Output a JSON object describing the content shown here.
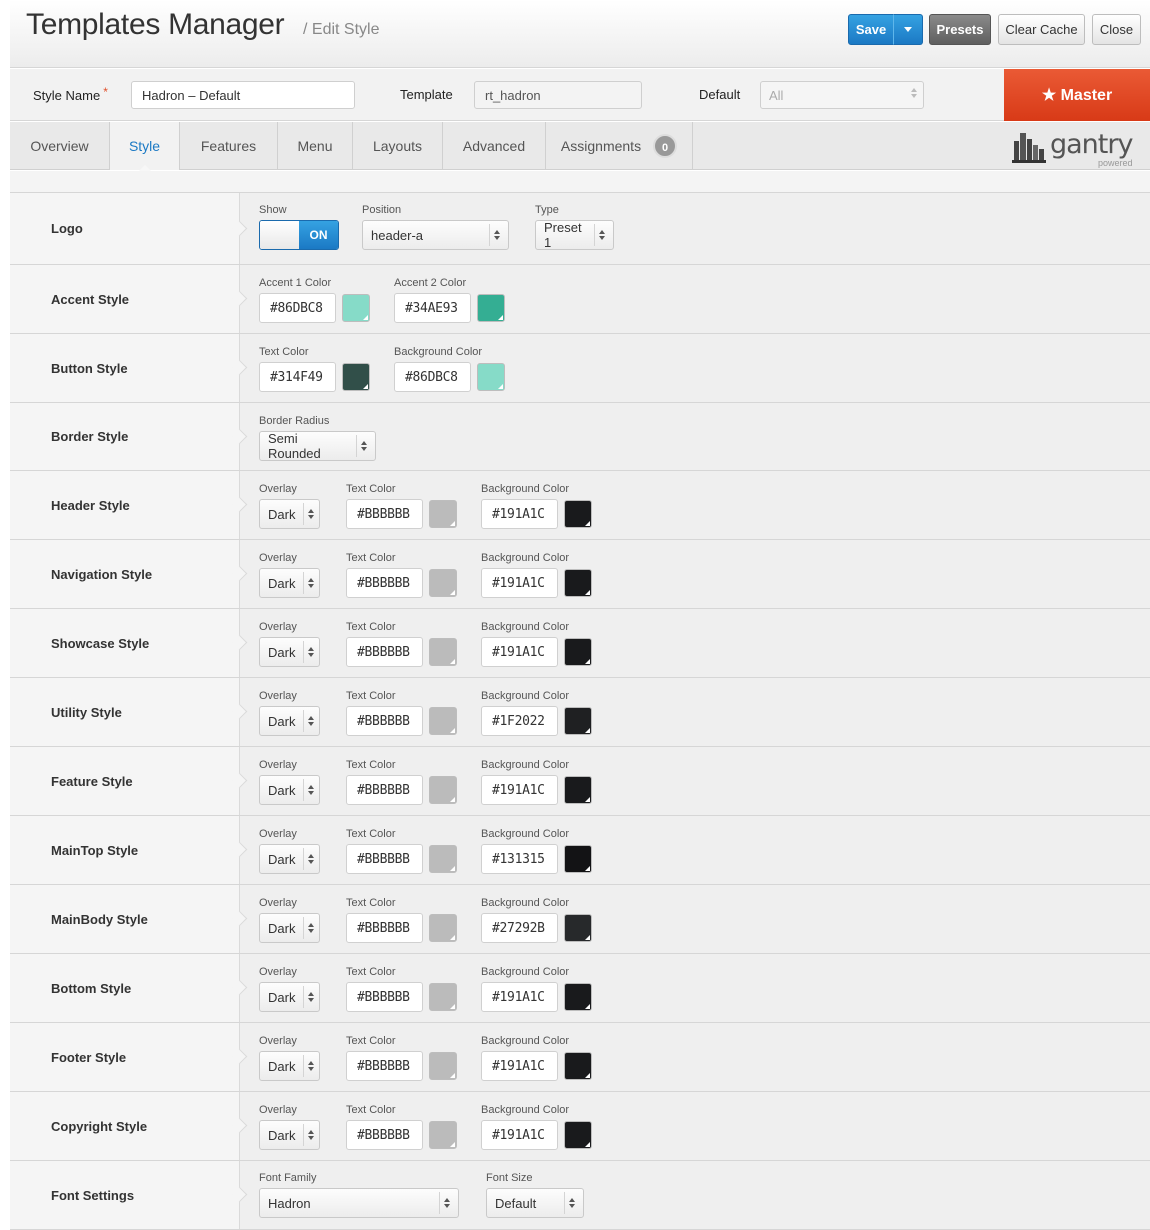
{
  "header": {
    "title": "Templates Manager",
    "subtitle": "/ Edit Style",
    "buttons": {
      "save": "Save",
      "presets": "Presets",
      "clear_cache": "Clear Cache",
      "close": "Close"
    }
  },
  "info": {
    "style_name_label": "Style Name",
    "required_mark": "*",
    "style_name_value": "Hadron – Default",
    "template_label": "Template",
    "template_value": "rt_hadron",
    "default_label": "Default",
    "default_value": "All",
    "master_label": "★ Master"
  },
  "tabs": [
    {
      "label": "Overview"
    },
    {
      "label": "Style",
      "active": true
    },
    {
      "label": "Features"
    },
    {
      "label": "Menu"
    },
    {
      "label": "Layouts"
    },
    {
      "label": "Advanced"
    },
    {
      "label": "Assignments",
      "badge": "0"
    }
  ],
  "brand": {
    "name": "gantry",
    "sub": "powered"
  },
  "labels": {
    "show": "Show",
    "position": "Position",
    "type": "Type",
    "overlay": "Overlay",
    "text_color": "Text Color",
    "background_color": "Background Color",
    "accent1": "Accent 1 Color",
    "accent2": "Accent 2 Color",
    "border_radius": "Border Radius",
    "font_family": "Font Family",
    "font_size": "Font Size"
  },
  "logo_row": {
    "label": "Logo",
    "show": "ON",
    "position": "header-a",
    "type": "Preset 1"
  },
  "accent_row": {
    "label": "Accent Style",
    "accent1": "#86DBC8",
    "accent2": "#34AE93"
  },
  "button_row": {
    "label": "Button Style",
    "text_color": "#314F49",
    "background_color": "#86DBC8"
  },
  "border_row": {
    "label": "Border Style",
    "radius": "Semi Rounded"
  },
  "section_rows": [
    {
      "label": "Header Style",
      "overlay": "Dark",
      "text": "#BBBBBB",
      "bg": "#191A1C"
    },
    {
      "label": "Navigation Style",
      "overlay": "Dark",
      "text": "#BBBBBB",
      "bg": "#191A1C"
    },
    {
      "label": "Showcase Style",
      "overlay": "Dark",
      "text": "#BBBBBB",
      "bg": "#191A1C"
    },
    {
      "label": "Utility Style",
      "overlay": "Dark",
      "text": "#BBBBBB",
      "bg": "#1F2022"
    },
    {
      "label": "Feature Style",
      "overlay": "Dark",
      "text": "#BBBBBB",
      "bg": "#191A1C"
    },
    {
      "label": "MainTop Style",
      "overlay": "Dark",
      "text": "#BBBBBB",
      "bg": "#131315"
    },
    {
      "label": "MainBody Style",
      "overlay": "Dark",
      "text": "#BBBBBB",
      "bg": "#27292B"
    },
    {
      "label": "Bottom Style",
      "overlay": "Dark",
      "text": "#BBBBBB",
      "bg": "#191A1C"
    },
    {
      "label": "Footer Style",
      "overlay": "Dark",
      "text": "#BBBBBB",
      "bg": "#191A1C"
    },
    {
      "label": "Copyright Style",
      "overlay": "Dark",
      "text": "#BBBBBB",
      "bg": "#191A1C"
    }
  ],
  "font_row": {
    "label": "Font Settings",
    "family": "Hadron",
    "size": "Default"
  }
}
